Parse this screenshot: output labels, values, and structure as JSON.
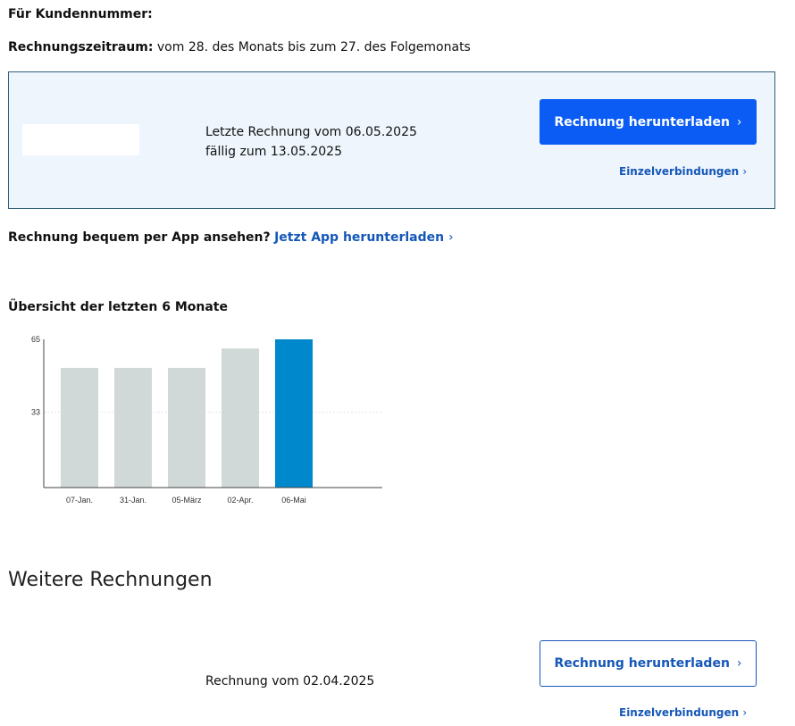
{
  "header": {
    "customer_label": "Für Kundennummer:",
    "period_label": "Rechnungszeitraum:",
    "period_value": "vom 28. des Monats bis zum 27. des Folgemonats"
  },
  "latest": {
    "line1": "Letzte Rechnung vom 06.05.2025",
    "line2": "fällig zum 13.05.2025",
    "download": "Rechnung herunterladen",
    "details": "Einzelverbindungen"
  },
  "app": {
    "question": "Rechnung bequem per App ansehen?",
    "link": "Jetzt App herunterladen"
  },
  "chart_title": "Übersicht der letzten 6 Monate",
  "chart_data": {
    "type": "bar",
    "categories": [
      "07-Jan.",
      "31-Jan.",
      "05-März",
      "02-Apr.",
      "06-Mai"
    ],
    "values": [
      52.5,
      52.5,
      52.5,
      61,
      65
    ],
    "yticks": [
      33,
      65
    ],
    "ylim": [
      0,
      65
    ],
    "highlight_color": "#0088cc",
    "bar_color": "#d1d9d8"
  },
  "more": {
    "title": "Weitere Rechnungen",
    "invoice": "Rechnung vom 02.04.2025",
    "download": "Rechnung herunterladen",
    "details": "Einzelverbindungen"
  },
  "icons": {
    "chevron": "›"
  }
}
